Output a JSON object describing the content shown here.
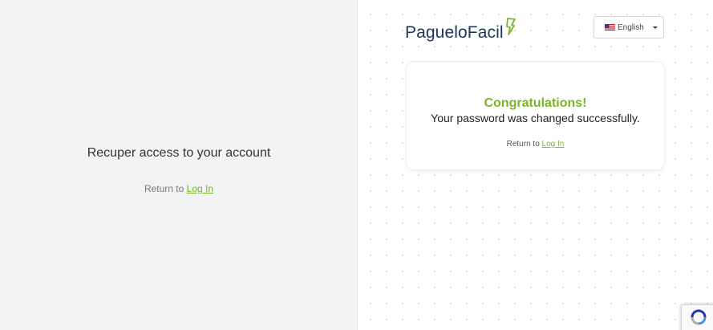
{
  "left": {
    "title": "Recuper access to your account",
    "return_prefix": "Return to",
    "return_link": "Log In"
  },
  "header": {
    "logo_text": "PagueloFacil",
    "language": {
      "selected": "English",
      "icon": "us-flag-icon"
    }
  },
  "card": {
    "title": "Congratulations!",
    "message": "Your password was changed successfully.",
    "return_prefix": "Return to",
    "return_link": "Log In"
  },
  "recaptcha": {
    "icon": "recaptcha-icon"
  },
  "colors": {
    "accent_green": "#7ab52b",
    "logo_navy": "#1d3557",
    "left_panel_bg": "#f1f3f5"
  }
}
